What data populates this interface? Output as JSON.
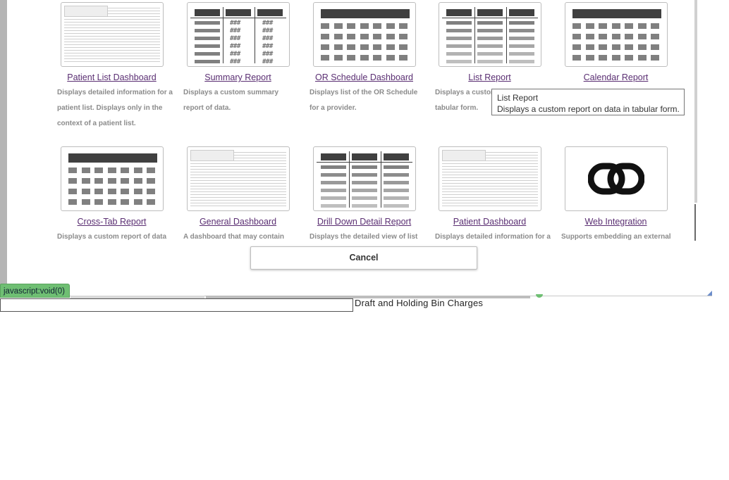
{
  "cards": [
    {
      "title": "Patient List Dashboard",
      "desc": "Displays detailed information for a patient list. Displays only in the context of a patient list.",
      "icon": "dashboard-screenshot-thumbnail"
    },
    {
      "title": "Summary Report",
      "desc": "Displays a custom summary report of data.",
      "icon": "summary-table-thumbnail"
    },
    {
      "title": "OR Schedule Dashboard",
      "desc": "Displays list of the OR Schedule for a provider.",
      "icon": "grid-thumbnail"
    },
    {
      "title": "List Report",
      "desc": "Displays a custom report on data in tabular form.",
      "icon": "list-table-thumbnail"
    },
    {
      "title": "Calendar Report",
      "desc": "",
      "icon": "grid-thumbnail"
    },
    {
      "title": "Cross-Tab Report",
      "desc": "Displays a custom report of data",
      "icon": "grid-thumbnail"
    },
    {
      "title": "General Dashboard",
      "desc": "A dashboard that may contain",
      "icon": "dashboard-screenshot-thumbnail"
    },
    {
      "title": "Drill Down Detail Report",
      "desc": "Displays the detailed view of list",
      "icon": "list-table-thumbnail"
    },
    {
      "title": "Patient Dashboard",
      "desc": "Displays detailed information for a",
      "icon": "dashboard-screenshot-thumbnail"
    },
    {
      "title": "Web Integration",
      "desc": "Supports embedding an external",
      "icon": "chain-link-icon"
    }
  ],
  "card4_desc_visible": "Displays a custom re",
  "card4_desc_line2": "tabular form.",
  "tooltip": {
    "title": "List Report",
    "text": "Displays a custom report on data in tabular form."
  },
  "cancel_label": "Cancel",
  "status_bar_text": "javascript:void(0)",
  "draft_label": "Draft and Holding Bin Charges",
  "hash_text": "###",
  "colors": {
    "link": "#5a2e72",
    "status_green": "#6fbf73",
    "thumb_dark": "#404040"
  }
}
